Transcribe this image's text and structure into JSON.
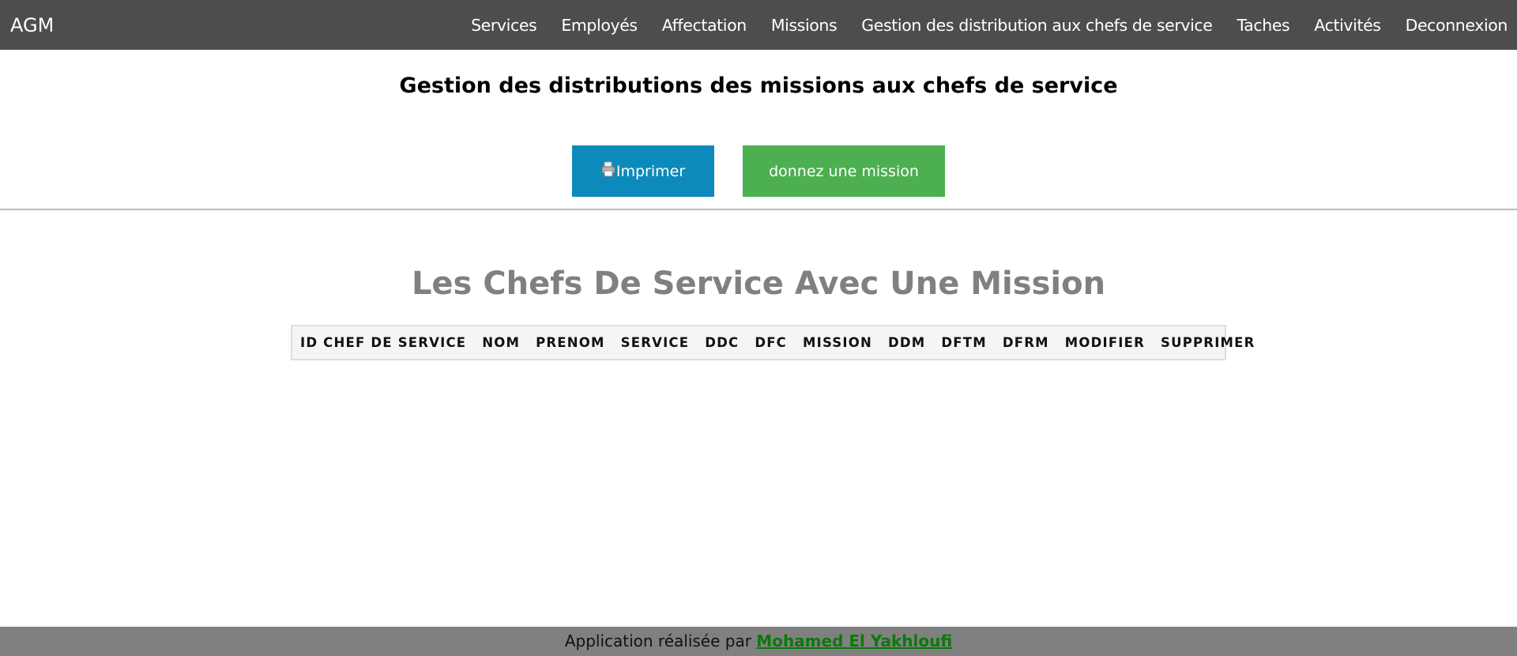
{
  "nav": {
    "brand": "AGM",
    "items": [
      {
        "label": "Services"
      },
      {
        "label": "Employés"
      },
      {
        "label": "Affectation"
      },
      {
        "label": "Missions"
      },
      {
        "label": "Gestion des distribution aux chefs de service"
      },
      {
        "label": "Taches"
      },
      {
        "label": "Activités"
      },
      {
        "label": "Deconnexion"
      }
    ]
  },
  "main": {
    "title": "Gestion des distributions des missions aux chefs de service",
    "print_button": "Imprimer",
    "print_icon": "printer-icon",
    "mission_button": "donnez une mission",
    "section_title": "Les Chefs De Service Avec Une Mission"
  },
  "table": {
    "columns": [
      "ID CHEF DE SERVICE",
      "NOM",
      "PRENOM",
      "SERVICE",
      "DDC",
      "DFC",
      "MISSION",
      "DDM",
      "DFTM",
      "DFRM",
      "MODIFIER",
      "SUPPRIMER"
    ],
    "rows": []
  },
  "footer": {
    "text": "Application réalisée par",
    "author": "Mohamed El Yakhloufi"
  },
  "colors": {
    "nav_bg": "#4d4d4d",
    "print_button": "#0d8abc",
    "mission_button": "#4caf50",
    "footer_bg": "#808080",
    "footer_link": "#0a7a0a"
  }
}
